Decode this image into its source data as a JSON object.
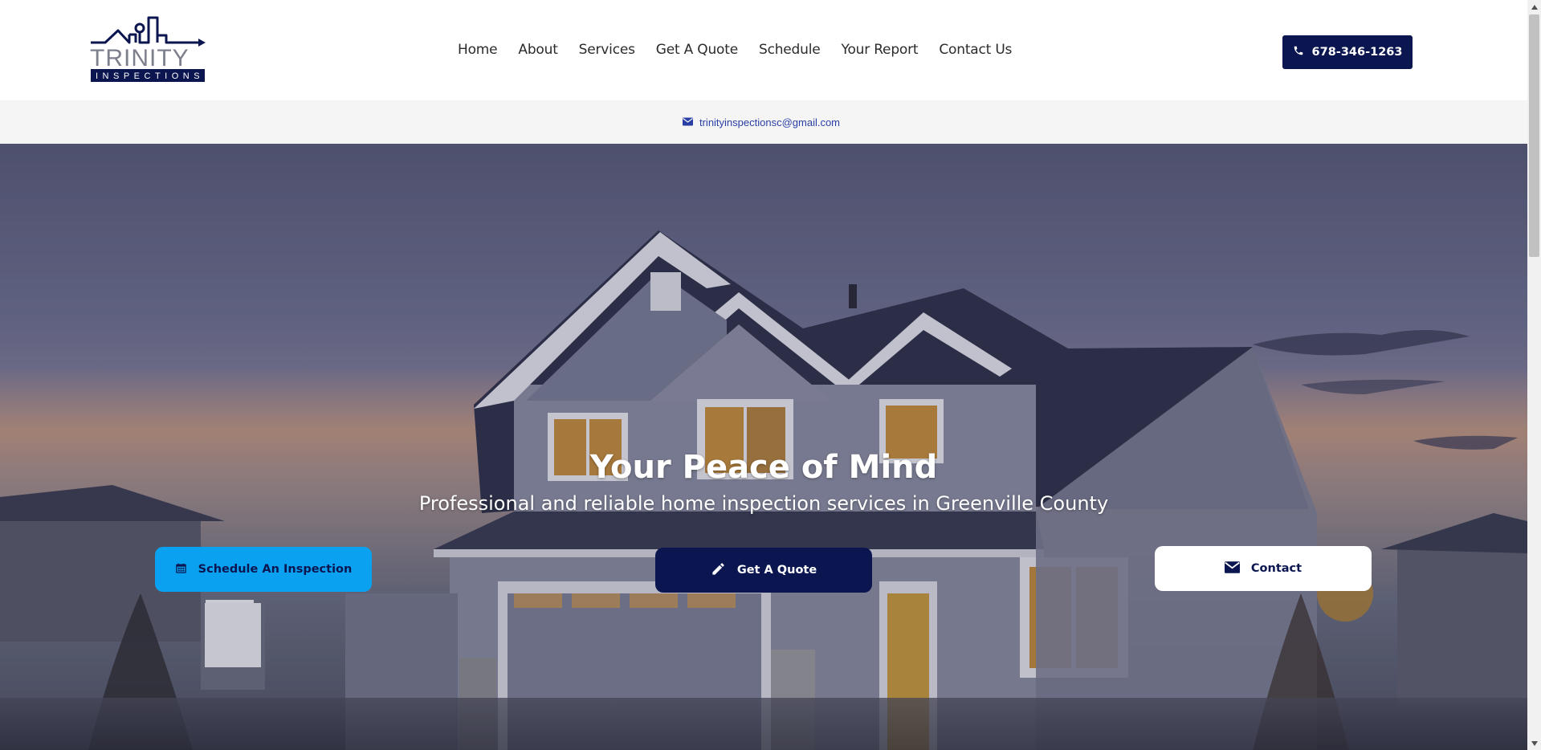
{
  "logo": {
    "line1": "TRINITY",
    "line2": "INSPECTIONS"
  },
  "nav": {
    "items": [
      "Home",
      "About",
      "Services",
      "Get A Quote",
      "Schedule",
      "Your Report",
      "Contact Us"
    ]
  },
  "header": {
    "phone_label": "678-346-1263",
    "phone_icon": "phone-icon"
  },
  "email_bar": {
    "email": "trinityinspectionsc@gmail.com",
    "icon": "envelope-icon"
  },
  "hero": {
    "title": "Your Peace of Mind",
    "subtitle": "Professional and reliable home inspection services in Greenville County",
    "buttons": {
      "schedule": "Schedule An Inspection",
      "quote": "Get A Quote",
      "contact": "Contact"
    }
  },
  "colors": {
    "brand_navy": "#0b1651",
    "accent_blue": "#0aa2f0",
    "email_link": "#2a3fa6"
  }
}
